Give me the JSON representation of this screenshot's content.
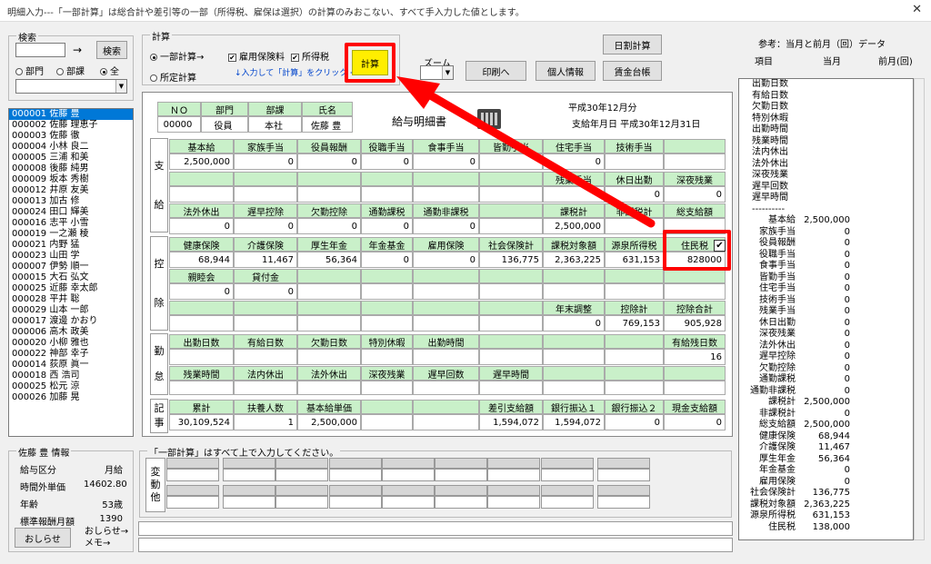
{
  "window": {
    "title": "明細入力---「一部計算」は総合計や差引等の一部（所得税、雇保は選択）の計算のみおこない、すべて手入力した値とします。",
    "close": "✕"
  },
  "search": {
    "group": "検索",
    "arrow": "→",
    "button": "検索",
    "radios": [
      "部門",
      "部課",
      "全"
    ],
    "selected": 2
  },
  "employees": [
    "000001 佐藤 豊",
    "000002 佐藤 理恵子",
    "000003 佐藤 徹",
    "000004 小林 良二",
    "000005 三浦 和美",
    "000008 後藤 純男",
    "000009 坂本 秀樹",
    "000012 井原 友美",
    "000013 加古 修",
    "000024 田口 輝美",
    "000016 志平 小雪",
    "000019 一之瀬 稜",
    "000021 内野 猛",
    "000023 山田 学",
    "000007 伊勢 順一",
    "000015 大石 弘文",
    "000025 近藤 幸太郎",
    "000028 平井 聡",
    "000029 山本 一郎",
    "000017 渡邊 かおり",
    "000006 高木 政美",
    "000020 小柳 雅也",
    "000022 神部 幸子",
    "000014 荻原 眞一",
    "000018 西 浩司",
    "000025 松元 涼",
    "000026 加藤 晃"
  ],
  "calc": {
    "group": "計算",
    "partial": "一部計算→",
    "fixed": "所定計算",
    "koyou": "雇用保険料",
    "shotoku": "所得税",
    "hint": "↓入力して「計算」をクリック ⇒",
    "button": "計算"
  },
  "zoom": {
    "label": "ズーム"
  },
  "buttons": {
    "daily": "日割計算",
    "print": "印刷へ",
    "personal": "個人情報",
    "ledger": "賃金台帳"
  },
  "reference": {
    "title": "参考：当月と前月（回）データ",
    "col_item": "項目",
    "col_cur": "当月",
    "col_prev": "前月(回)"
  },
  "ref_top": [
    "出勤日数",
    "有給日数",
    "欠勤日数",
    "特別休暇",
    "出勤時間",
    "残業時間",
    "法内休出",
    "法外休出",
    "深夜残業",
    "遅早回数",
    "遅早時間"
  ],
  "ref_sep": "----------",
  "ref_rows": [
    [
      "基本給",
      "2,500,000"
    ],
    [
      "家族手当",
      "0"
    ],
    [
      "役員報酬",
      "0"
    ],
    [
      "役職手当",
      "0"
    ],
    [
      "食事手当",
      "0"
    ],
    [
      "皆勤手当",
      "0"
    ],
    [
      "住宅手当",
      "0"
    ],
    [
      "技術手当",
      "0"
    ],
    [
      "残業手当",
      "0"
    ],
    [
      "休日出勤",
      "0"
    ],
    [
      "深夜残業",
      "0"
    ],
    [
      "法外休出",
      "0"
    ],
    [
      "遅早控除",
      "0"
    ],
    [
      "欠勤控除",
      "0"
    ],
    [
      "通勤課税",
      "0"
    ],
    [
      "通勤非課税",
      "0"
    ],
    [
      "課税計",
      "2,500,000"
    ],
    [
      "非課税計",
      "0"
    ],
    [
      "総支給額",
      "2,500,000"
    ],
    [
      "健康保険",
      "68,944"
    ],
    [
      "介護保険",
      "11,467"
    ],
    [
      "厚生年金",
      "56,364"
    ],
    [
      "年金基金",
      "0"
    ],
    [
      "雇用保険",
      "0"
    ],
    [
      "社会保険計",
      "136,775"
    ],
    [
      "課税対象額",
      "2,363,225"
    ],
    [
      "源泉所得税",
      "631,153"
    ],
    [
      "住民税",
      "138,000"
    ]
  ],
  "slip": {
    "no_h": "ＮＯ",
    "dept_h": "部門",
    "ka_h": "部課",
    "name_h": "氏名",
    "no": "00000",
    "dept": "役員",
    "ka": "本社",
    "name": "佐藤 豊",
    "title": "給与明細書",
    "period": "平成30年12月分",
    "paydate": "支給年月日 平成30年12月31日",
    "sec_pay": [
      "支",
      "給"
    ],
    "sec_ded": [
      "控",
      "除"
    ],
    "sec_att": [
      "勤",
      "怠"
    ],
    "sec_rec": [
      "記",
      "事"
    ],
    "pay1_h": [
      "基本給",
      "家族手当",
      "役員報酬",
      "役職手当",
      "食事手当",
      "皆勤手当",
      "住宅手当",
      "技術手当",
      ""
    ],
    "pay1_v": [
      "2,500,000",
      "0",
      "0",
      "0",
      "0",
      "",
      "0",
      "",
      ""
    ],
    "pay2_h": [
      "",
      "",
      "",
      "",
      "",
      "",
      "残業手当",
      "休日出勤",
      "深夜残業"
    ],
    "pay2_v": [
      "",
      "",
      "",
      "",
      "",
      "",
      "",
      "0",
      "0"
    ],
    "pay3_h": [
      "法外休出",
      "遅早控除",
      "欠勤控除",
      "通勤課税",
      "通勤非課税",
      "",
      "課税計",
      "非課税計",
      "総支給額"
    ],
    "pay3_v": [
      "0",
      "0",
      "0",
      "0",
      "0",
      "",
      "2,500,000",
      "",
      ""
    ],
    "ded1_h": [
      "健康保険",
      "介護保険",
      "厚生年金",
      "年金基金",
      "雇用保険",
      "社会保険計",
      "課税対象額",
      "源泉所得税",
      "住民税"
    ],
    "ded1_v": [
      "68,944",
      "11,467",
      "56,364",
      "0",
      "0",
      "136,775",
      "2,363,225",
      "631,153",
      "828000"
    ],
    "ded2_h": [
      "親睦会",
      "貸付金",
      "",
      "",
      "",
      "",
      "",
      "",
      ""
    ],
    "ded2_v": [
      "0",
      "0",
      "",
      "",
      "",
      "",
      "",
      "",
      ""
    ],
    "ded3_h": [
      "",
      "",
      "",
      "",
      "",
      "",
      "年末調整",
      "控除計",
      "控除合計"
    ],
    "ded3_v": [
      "",
      "",
      "",
      "",
      "",
      "",
      "0",
      "769,153",
      "905,928"
    ],
    "att1_h": [
      "出勤日数",
      "有給日数",
      "欠勤日数",
      "特別休暇",
      "出勤時間",
      "",
      "",
      "",
      "有給残日数"
    ],
    "att1_v": [
      "",
      "",
      "",
      "",
      "",
      "",
      "",
      "",
      "16"
    ],
    "att2_h": [
      "残業時間",
      "法内休出",
      "法外休出",
      "深夜残業",
      "遅早回数",
      "遅早時間",
      "",
      "",
      ""
    ],
    "rec_h": [
      "累計",
      "扶養人数",
      "基本給単価",
      "",
      "",
      "差引支給額",
      "銀行振込１",
      "銀行振込２",
      "現金支給額"
    ],
    "rec_v": [
      "30,109,524",
      "1",
      "2,500,000",
      "",
      "",
      "1,594,072",
      "1,594,072",
      "0",
      "0"
    ],
    "check": "✔"
  },
  "info": {
    "group": "佐藤 豊 情報",
    "rows": [
      [
        "給与区分",
        "月給"
      ],
      [
        "時間外単価",
        "14602.80"
      ],
      [
        "年齢",
        "53歳"
      ],
      [
        "標準報酬月額",
        "1390"
      ]
    ],
    "notice": "おしらせ",
    "memo": "おしらせ→\nメモ→"
  },
  "partial_note": {
    "group": "「一部計算」はすべて上で入力してください。",
    "label": [
      "変",
      "動",
      "他"
    ]
  },
  "highlight_color": "#ff0000",
  "header_green": "#c9f0c9"
}
